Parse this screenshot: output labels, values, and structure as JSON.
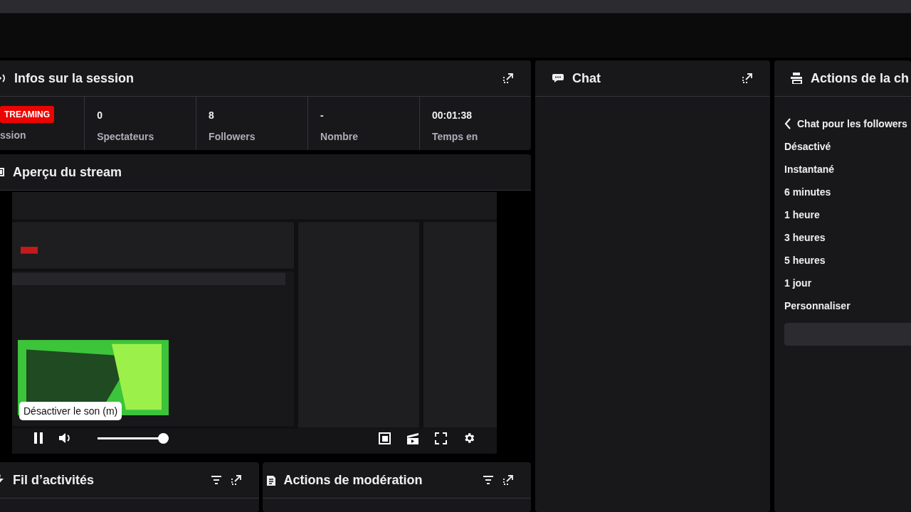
{
  "session": {
    "title": "Infos sur la session",
    "badge": "TREAMING",
    "badge_label": "ssion",
    "stats": [
      {
        "value": "0",
        "label": "Spectateurs"
      },
      {
        "value": "8",
        "label": "Followers"
      },
      {
        "value": "-",
        "label": "Nombre"
      },
      {
        "value": "00:01:38",
        "label": "Temps en"
      }
    ]
  },
  "preview": {
    "title": "Aperçu du stream",
    "playing": true,
    "tooltip": "Désactiver le son (m)",
    "volume": {
      "level": 1
    }
  },
  "chat": {
    "title": "Chat"
  },
  "chat_actions": {
    "title": "Actions de la ch",
    "back_label": "Chat pour les followers",
    "options": [
      "Désactivé",
      "Instantané",
      "6 minutes",
      "1 heure",
      "3 heures",
      "5 heures",
      "1 jour",
      "Personnaliser"
    ]
  },
  "bottom_panels": [
    {
      "kind": "activity",
      "title": "Fil d’activités"
    },
    {
      "kind": "moderation",
      "title": "Actions de modération"
    }
  ]
}
